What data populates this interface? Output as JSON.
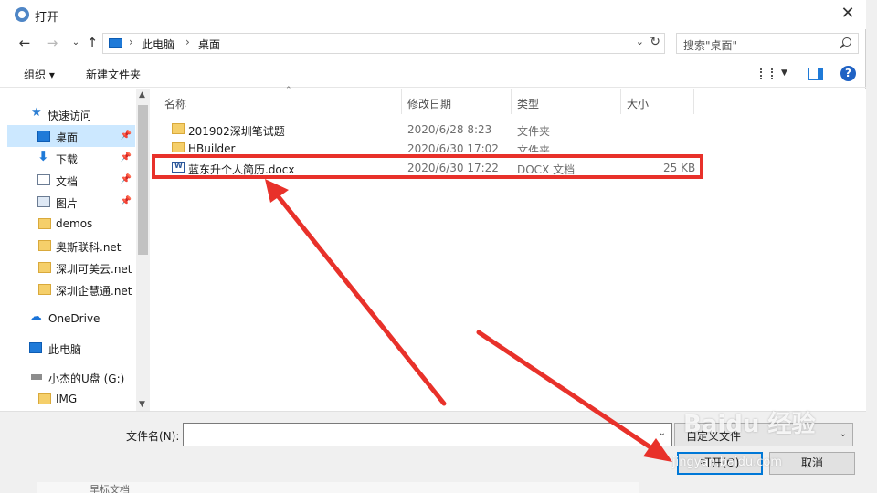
{
  "window": {
    "title": "打开",
    "close_glyph": "✕"
  },
  "address": {
    "crumbs": [
      "此电脑",
      "桌面"
    ],
    "sep": "›",
    "search_placeholder": "搜索\"桌面\""
  },
  "toolbar": {
    "organize": "组织 ▾",
    "new_folder": "新建文件夹",
    "help": "?"
  },
  "nav": {
    "items": [
      {
        "label": "快速访问",
        "icon": "star-icon"
      },
      {
        "label": "桌面",
        "icon": "desktop-icon",
        "pinned": true,
        "selected": true
      },
      {
        "label": "下载",
        "icon": "download-icon",
        "pinned": true
      },
      {
        "label": "文档",
        "icon": "document-icon",
        "pinned": true
      },
      {
        "label": "图片",
        "icon": "picture-icon",
        "pinned": true
      },
      {
        "label": "demos",
        "icon": "folder-icon"
      },
      {
        "label": "奥斯联科.net",
        "icon": "folder-icon"
      },
      {
        "label": "深圳可美云.net",
        "icon": "folder-icon"
      },
      {
        "label": "深圳企慧通.net",
        "icon": "folder-icon"
      },
      {
        "label": "OneDrive",
        "icon": "onedrive-icon"
      },
      {
        "label": "此电脑",
        "icon": "computer-icon"
      },
      {
        "label": "小杰的U盘 (G:)",
        "icon": "usb-drive-icon"
      },
      {
        "label": "IMG",
        "icon": "folder-icon"
      }
    ]
  },
  "columns": {
    "name": "名称",
    "modified": "修改日期",
    "type": "类型",
    "size": "大小"
  },
  "files": [
    {
      "name": "201902深圳笔试题",
      "modified": "2020/6/28 8:23",
      "type": "文件夹",
      "size": "",
      "icon": "folder-icon"
    },
    {
      "name": "HBuilder",
      "modified": "2020/6/30 17:02",
      "type": "文件夹",
      "size": "",
      "icon": "folder-icon"
    },
    {
      "name": "蓝东升个人简历.docx",
      "modified": "2020/6/30 17:22",
      "type": "DOCX 文档",
      "size": "25 KB",
      "icon": "word-doc-icon"
    }
  ],
  "footer": {
    "filename_label": "文件名(N):",
    "filename_value": "",
    "filetype": "自定义文件",
    "open_button": "打开(O)",
    "cancel_button": "取消"
  },
  "background_text": "早标文档",
  "watermark": {
    "main": "Baidu 经验",
    "sub": "jingyan.baidu.com"
  },
  "colors": {
    "accent": "#0078d7",
    "selection": "#cce8ff",
    "annotation": "#e8312a",
    "folder": "#f5cf6a"
  }
}
